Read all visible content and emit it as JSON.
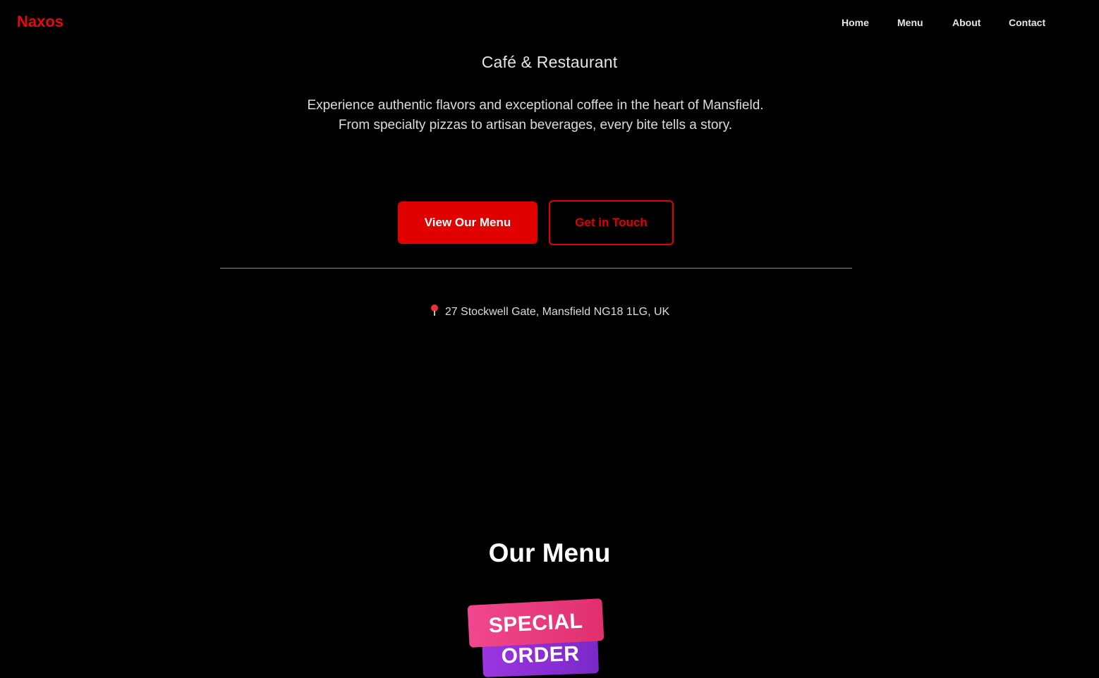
{
  "header": {
    "brand": "Naxos",
    "nav": [
      "Home",
      "Menu",
      "About",
      "Contact"
    ]
  },
  "hero": {
    "tagline": "Café & Restaurant",
    "intro": "Experience authentic flavors and exceptional coffee in the heart of Mansfield. From specialty pizzas to artisan beverages, every bite tells a story.",
    "primary_button": "View Our Menu",
    "secondary_button": "Get in Touch",
    "address_icon": "map-pin-icon",
    "address": "27 Stockwell Gate, Mansfield NG18 1LG, UK"
  },
  "menu_section": {
    "title": "Our Menu",
    "badge_top": "SPECIAL",
    "badge_bottom": "ORDER"
  },
  "colors": {
    "background": "#000000",
    "accent": "#e00000",
    "brand": "#e50914",
    "badge_pink": "#e8387f",
    "badge_purple": "#8a2fd6"
  }
}
